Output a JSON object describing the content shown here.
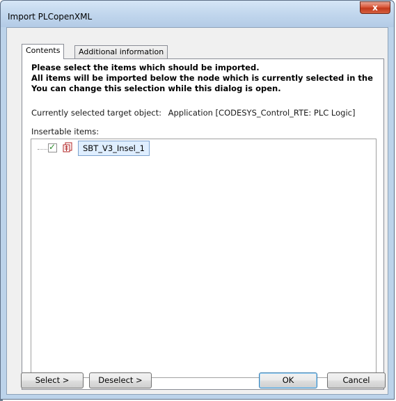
{
  "window": {
    "title": "Import PLCopenXML",
    "close_glyph": "x"
  },
  "tabs": [
    {
      "label": "Contents",
      "active": true
    },
    {
      "label": "Additional information",
      "active": false
    }
  ],
  "instructions": {
    "line1": "Please select the items which should be imported.",
    "line2": "All items will be imported below the node which is currently selected in the",
    "line3": "You can change this selection while this dialog is open."
  },
  "target": {
    "label": "Currently selected target object:",
    "value": "Application [CODESYS_Control_RTE: PLC Logic]"
  },
  "insertable": {
    "label": "Insertable items:",
    "items": [
      {
        "name": "SBT_V3_Insel_1",
        "checked": true,
        "icon": "pou-object-icon"
      }
    ]
  },
  "buttons": {
    "select": "Select >",
    "deselect": "Deselect >",
    "ok": "OK",
    "cancel": "Cancel"
  },
  "colors": {
    "check_green": "#2a8a2a",
    "selection_bg": "#dfeeff",
    "selection_border": "#7da2ce",
    "close_red": "#c2391b"
  }
}
